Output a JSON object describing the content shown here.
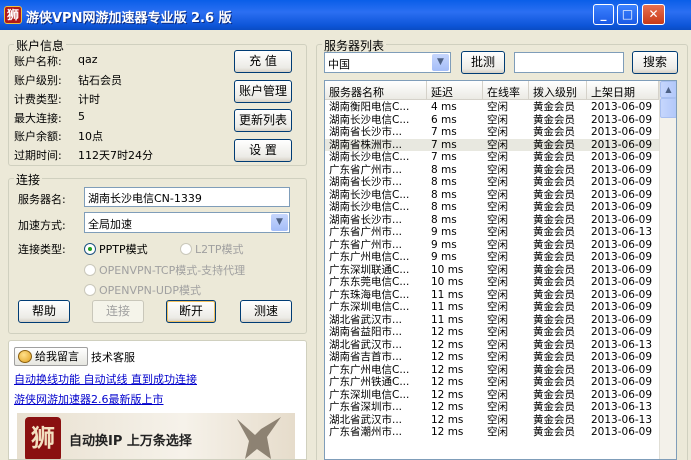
{
  "window": {
    "title": "游侠VPN网游加速器专业版 2.6 版",
    "icon_char": "狮",
    "minimize": "_",
    "maximize": "□",
    "close": "✕"
  },
  "account": {
    "group_label": "账户信息",
    "fields": [
      {
        "label": "账户名称:",
        "value": "qaz"
      },
      {
        "label": "账户级别:",
        "value": "钻石会员"
      },
      {
        "label": "计费类型:",
        "value": "计时"
      },
      {
        "label": "最大连接:",
        "value": "5"
      },
      {
        "label": "账户余额:",
        "value": "10点"
      },
      {
        "label": "过期时间:",
        "value": "112天7时24分"
      }
    ],
    "buttons": {
      "recharge": "充    值",
      "manage": "账户管理",
      "refresh_list": "更新列表",
      "settings": "设    置"
    }
  },
  "connection": {
    "group_label": "连接",
    "server_name_label": "服务器名:",
    "server_name_value": "湖南长沙电信CN-1339",
    "mode_label": "加速方式:",
    "mode_value": "全局加速",
    "type_label": "连接类型:",
    "types": [
      {
        "label": "PPTP模式",
        "checked": true,
        "enabled": true
      },
      {
        "label": "L2TP模式",
        "checked": false,
        "enabled": false
      },
      {
        "label": "OPENVPN-TCP模式-支持代理",
        "checked": false,
        "enabled": false
      },
      {
        "label": "OPENVPN-UDP模式",
        "checked": false,
        "enabled": false
      }
    ],
    "buttons": {
      "help": "帮助",
      "connect": "连接",
      "disconnect": "断开",
      "test_speed": "测速"
    }
  },
  "support": {
    "message_button": "给我留言",
    "tech_label": "技术客服",
    "links": [
      "自动换线功能 自动试线 直到成功连接",
      "游侠网游加速器2.6最新版上市"
    ],
    "banner_text": "自动换IP  上万条选择",
    "banner_logo_char": "狮"
  },
  "server_list": {
    "group_label": "服务器列表",
    "region_value": "中国",
    "batch_test_button": "批测",
    "search_placeholder": "",
    "search_button": "搜索",
    "columns": [
      "服务器名称",
      "延迟",
      "在线率",
      "拨入级别",
      "上架日期"
    ],
    "rows": [
      [
        "湖南衡阳电信C...",
        "4 ms",
        "空闲",
        "黄金会员",
        "2013-06-09"
      ],
      [
        "湖南长沙电信C...",
        "6 ms",
        "空闲",
        "黄金会员",
        "2013-06-09"
      ],
      [
        "湖南省长沙市...",
        "7 ms",
        "空闲",
        "黄金会员",
        "2013-06-09"
      ],
      [
        "湖南省株洲市...",
        "7 ms",
        "空闲",
        "黄金会员",
        "2013-06-09"
      ],
      [
        "湖南长沙电信C...",
        "7 ms",
        "空闲",
        "黄金会员",
        "2013-06-09"
      ],
      [
        "广东省广州市...",
        "8 ms",
        "空闲",
        "黄金会员",
        "2013-06-09"
      ],
      [
        "湖南省长沙市...",
        "8 ms",
        "空闲",
        "黄金会员",
        "2013-06-09"
      ],
      [
        "湖南长沙电信C...",
        "8 ms",
        "空闲",
        "黄金会员",
        "2013-06-09"
      ],
      [
        "湖南长沙电信C...",
        "8 ms",
        "空闲",
        "黄金会员",
        "2013-06-09"
      ],
      [
        "湖南省长沙市...",
        "8 ms",
        "空闲",
        "黄金会员",
        "2013-06-09"
      ],
      [
        "广东省广州市...",
        "9 ms",
        "空闲",
        "黄金会员",
        "2013-06-13"
      ],
      [
        "广东省广州市...",
        "9 ms",
        "空闲",
        "黄金会员",
        "2013-06-09"
      ],
      [
        "广东广州电信C...",
        "9 ms",
        "空闲",
        "黄金会员",
        "2013-06-09"
      ],
      [
        "广东深圳联通C...",
        "10 ms",
        "空闲",
        "黄金会员",
        "2013-06-09"
      ],
      [
        "广东东莞电信C...",
        "10 ms",
        "空闲",
        "黄金会员",
        "2013-06-09"
      ],
      [
        "广东珠海电信C...",
        "11 ms",
        "空闲",
        "黄金会员",
        "2013-06-09"
      ],
      [
        "广东深圳电信C...",
        "11 ms",
        "空闲",
        "黄金会员",
        "2013-06-09"
      ],
      [
        "湖北省武汉市...",
        "11 ms",
        "空闲",
        "黄金会员",
        "2013-06-09"
      ],
      [
        "湖南省益阳市...",
        "12 ms",
        "空闲",
        "黄金会员",
        "2013-06-09"
      ],
      [
        "湖北省武汉市...",
        "12 ms",
        "空闲",
        "黄金会员",
        "2013-06-13"
      ],
      [
        "湖南省吉首市...",
        "12 ms",
        "空闲",
        "黄金会员",
        "2013-06-09"
      ],
      [
        "广东广州电信C...",
        "12 ms",
        "空闲",
        "黄金会员",
        "2013-06-09"
      ],
      [
        "广东广州铁通C...",
        "12 ms",
        "空闲",
        "黄金会员",
        "2013-06-09"
      ],
      [
        "广东深圳电信C...",
        "12 ms",
        "空闲",
        "黄金会员",
        "2013-06-09"
      ],
      [
        "广东省深圳市...",
        "12 ms",
        "空闲",
        "黄金会员",
        "2013-06-13"
      ],
      [
        "湖北省武汉市...",
        "12 ms",
        "空闲",
        "黄金会员",
        "2013-06-13"
      ],
      [
        "广东省潮州市...",
        "12 ms",
        "空闲",
        "黄金会员",
        "2013-06-09"
      ]
    ],
    "selected_row": 3
  }
}
